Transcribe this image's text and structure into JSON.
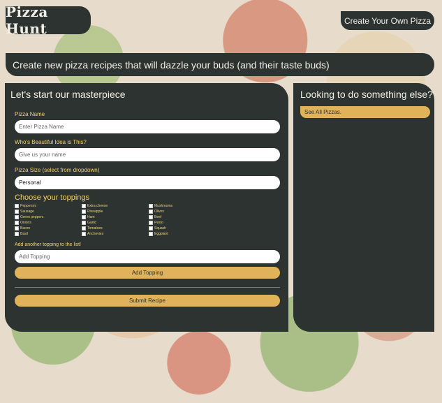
{
  "header": {
    "logo_text": "Pizza Hunt",
    "create_button": "Create Your Own Pizza"
  },
  "tagline": "Create new pizza recipes that will dazzle your buds (and their taste buds)",
  "form": {
    "title": "Let's start our masterpiece",
    "pizza_name_label": "Pizza Name",
    "pizza_name_placeholder": "Enter Pizza Name",
    "creator_label": "Who's Beautiful Idea is This?",
    "creator_placeholder": "Give us your name",
    "size_label": "Pizza Size (select from dropdown)",
    "size_value": "Personal",
    "toppings_title": "Choose your toppings",
    "toppings": {
      "col1": [
        "Pepperoni",
        "Sausage",
        "Green peppers",
        "Onions",
        "Bacon",
        "Basil"
      ],
      "col2": [
        "Extra cheese",
        "Pineapple",
        "Ham",
        "Garlic",
        "Tomatoes",
        "Anchovies"
      ],
      "col3": [
        "Mushrooms",
        "Olives",
        "Beef",
        "Pesto",
        "Squash",
        "Eggplant"
      ]
    },
    "add_topping_label": "Add another topping to the list!",
    "add_topping_placeholder": "Add Topping",
    "add_topping_button": "Add Topping",
    "submit_button": "Submit Recipe"
  },
  "sidebar": {
    "title": "Looking to do something else?",
    "link": "See All Pizzas."
  },
  "colors": {
    "panel": "#2c3331",
    "accent": "#e0b35a",
    "label": "#f1d26b"
  }
}
